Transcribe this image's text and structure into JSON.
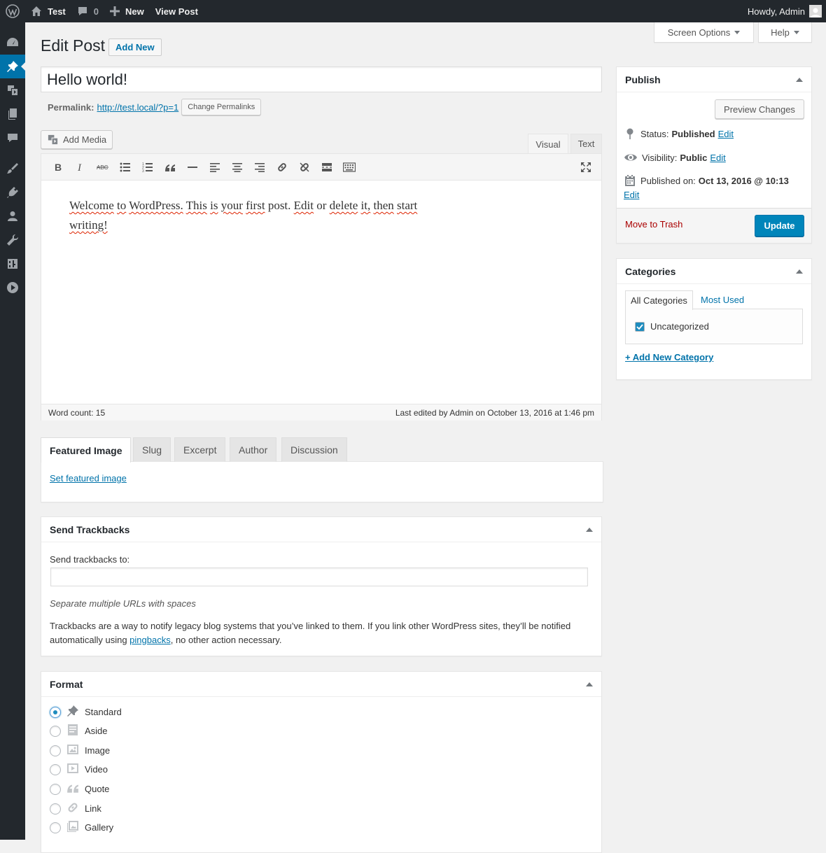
{
  "adminbar": {
    "site_name": "Test",
    "comments_count": "0",
    "new_label": "New",
    "view_post_label": "View Post",
    "howdy": "Howdy, Admin"
  },
  "screen_options": {
    "label": "Screen Options"
  },
  "help": {
    "label": "Help"
  },
  "page": {
    "title": "Edit Post",
    "add_new_label": "Add New"
  },
  "post": {
    "title": "Hello world!",
    "permalink_label": "Permalink:",
    "permalink_url": "http://test.local/?p=1",
    "change_permalinks_label": "Change Permalinks"
  },
  "editor": {
    "add_media_label": "Add Media",
    "tab_visual": "Visual",
    "tab_text": "Text",
    "content_words": [
      "Welcome",
      "to",
      "WordPress.",
      "This",
      "is",
      "your",
      "first",
      "post.",
      "Edit",
      "or",
      "delete",
      "it,",
      "then",
      "start",
      "writing!"
    ],
    "word_count": "Word count: 15",
    "last_edited": "Last edited by Admin on October 13, 2016 at 1:46 pm"
  },
  "metabox_tabs": [
    "Featured Image",
    "Slug",
    "Excerpt",
    "Author",
    "Discussion"
  ],
  "featured_image": {
    "link": "Set featured image"
  },
  "trackbacks": {
    "title": "Send Trackbacks",
    "label": "Send trackbacks to:",
    "value": "",
    "hint": "Separate multiple URLs with spaces",
    "desc_before": "Trackbacks are a way to notify legacy blog systems that you’ve linked to them. If you link other WordPress sites, they’ll be notified automatically using ",
    "desc_link": "pingbacks",
    "desc_after": ", no other action necessary."
  },
  "format": {
    "title": "Format",
    "options": [
      "Standard",
      "Aside",
      "Image",
      "Video",
      "Quote",
      "Link",
      "Gallery"
    ],
    "selected": "Standard"
  },
  "publish": {
    "title": "Publish",
    "preview_label": "Preview Changes",
    "status_label": "Status:",
    "status_value": "Published",
    "visibility_label": "Visibility:",
    "visibility_value": "Public",
    "published_label": "Published on:",
    "published_value": "Oct 13, 2016 @ 10:13",
    "edit_label": "Edit",
    "trash_label": "Move to Trash",
    "update_label": "Update"
  },
  "categories": {
    "title": "Categories",
    "tab_all": "All Categories",
    "tab_used": "Most Used",
    "items": [
      {
        "label": "Uncategorized",
        "checked": true
      }
    ],
    "add_new": "+ Add New Category"
  },
  "colors": {
    "accent": "#0073aa",
    "button": "#0085ba",
    "danger": "#a00",
    "adminbar": "#23282d"
  }
}
